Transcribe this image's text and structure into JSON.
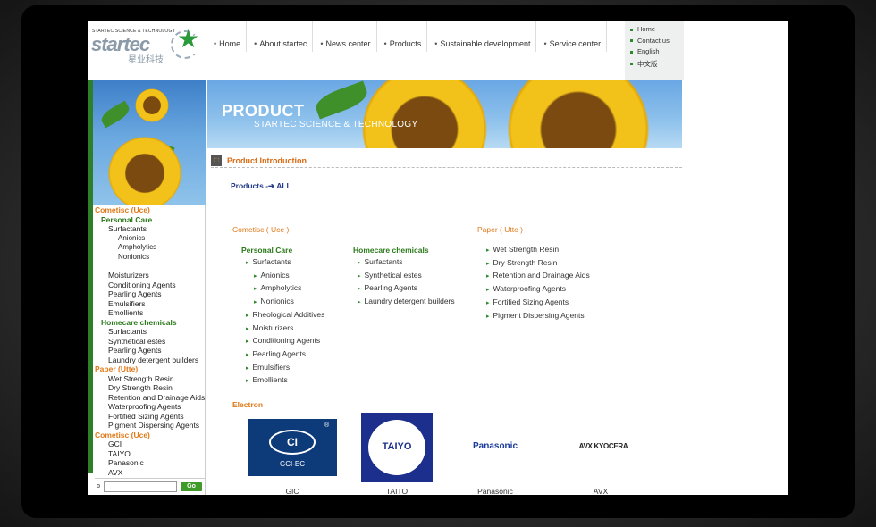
{
  "header": {
    "logo_tagline": "STARTEC SCIENCE & TECHNOLOGY",
    "logo_word": "startec",
    "logo_cn": "星业科技",
    "nav": [
      "Home",
      "About startec",
      "News center",
      "Products",
      "Sustainable development",
      "Service center"
    ],
    "quick_links": [
      "Home",
      "Contact us",
      "English",
      "中文版"
    ]
  },
  "banner": {
    "title": "PRODUCT",
    "subtitle": "STARTEC SCIENCE & TECHNOLOGY"
  },
  "sidebar": {
    "items": [
      {
        "t": "Cometisc (Uce)",
        "c": "h1"
      },
      {
        "t": "Personal Care",
        "c": "h2"
      },
      {
        "t": "Surfactants",
        "c": "l3"
      },
      {
        "t": "Anionics",
        "c": "l4"
      },
      {
        "t": "Ampholytics",
        "c": "l4"
      },
      {
        "t": "Nonionics",
        "c": "l4"
      },
      {
        "t": "",
        "c": "gap"
      },
      {
        "t": "Moisturizers",
        "c": "l3"
      },
      {
        "t": "Conditioning Agents",
        "c": "l3"
      },
      {
        "t": "Pearling Agents",
        "c": "l3"
      },
      {
        "t": "Emulsifiers",
        "c": "l3"
      },
      {
        "t": "Emollients",
        "c": "l3"
      },
      {
        "t": "Homecare chemicals",
        "c": "h2"
      },
      {
        "t": "Surfactants",
        "c": "l3"
      },
      {
        "t": "Synthetical estes",
        "c": "l3"
      },
      {
        "t": "Pearling Agents",
        "c": "l3"
      },
      {
        "t": "Laundry detergent builders",
        "c": "l3"
      },
      {
        "t": "Paper (Utte)",
        "c": "h1"
      },
      {
        "t": "Wet Strength Resin",
        "c": "l3"
      },
      {
        "t": "Dry Strength Resin",
        "c": "l3"
      },
      {
        "t": "Retention and Drainage Aids",
        "c": "l3"
      },
      {
        "t": "Waterproofing Agents",
        "c": "l3"
      },
      {
        "t": "Fortified Sizing Agents",
        "c": "l3"
      },
      {
        "t": "Pigment Dispersing Agents",
        "c": "l3"
      },
      {
        "t": "Cometisc (Uce)",
        "c": "h1"
      },
      {
        "t": "GCI",
        "c": "l3"
      },
      {
        "t": "TAIYO",
        "c": "l3"
      },
      {
        "t": "Panasonic",
        "c": "l3"
      },
      {
        "t": "AVX",
        "c": "l3"
      }
    ],
    "search_value": "",
    "go_label": "Go"
  },
  "content": {
    "section_title": "Product Introduction",
    "breadcrumb": "Products -➔ ALL",
    "col1_title": "Cometisc ( Uce )",
    "personal_care": "Personal Care",
    "pc_items": [
      {
        "t": "Surfactants",
        "d": 0
      },
      {
        "t": "Anionics",
        "d": 1
      },
      {
        "t": "Ampholytics",
        "d": 1
      },
      {
        "t": "Nonionics",
        "d": 1
      },
      {
        "t": "Rheological Additives",
        "d": 0
      },
      {
        "t": "Moisturizers",
        "d": 0
      },
      {
        "t": "Conditioning Agents",
        "d": 0
      },
      {
        "t": "Pearling Agents",
        "d": 0
      },
      {
        "t": "Emulsifiers",
        "d": 0
      },
      {
        "t": "Emollients",
        "d": 0
      }
    ],
    "homecare": "Homecare chemicals",
    "hc_items": [
      "Surfactants",
      "Synthetical estes",
      "Pearling Agents",
      "Laundry detergent builders"
    ],
    "col3_title": "Paper ( Utte )",
    "paper_items": [
      "Wet Strength Resin",
      "Dry Strength Resin",
      "Retention and Drainage Aids",
      "Waterproofing Agents",
      "Fortified Sizing Agents",
      "Pigment Dispersing Agents"
    ],
    "electron_title": "Electron",
    "brands": [
      {
        "caption": "GIC",
        "logo_text": "GCI-EC"
      },
      {
        "caption": "TAITO",
        "logo_text": "TAIYO"
      },
      {
        "caption": "Panasonic",
        "logo_text": "Panasonic"
      },
      {
        "caption": "AVX",
        "logo_text": "AVX KYOCERA"
      }
    ]
  },
  "colors": {
    "accent_orange": "#e07a1a",
    "accent_green": "#2a7a1a",
    "link_blue": "#223a8a"
  }
}
